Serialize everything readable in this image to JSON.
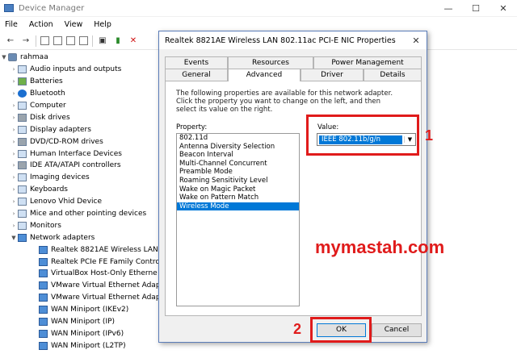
{
  "window": {
    "title": "Device Manager",
    "controls": [
      "—",
      "☐",
      "✕"
    ]
  },
  "menu": [
    "File",
    "Action",
    "View",
    "Help"
  ],
  "tree": {
    "root": "rahmaa",
    "categories": [
      "Audio inputs and outputs",
      "Batteries",
      "Bluetooth",
      "Computer",
      "Disk drives",
      "Display adapters",
      "DVD/CD-ROM drives",
      "Human Interface Devices",
      "IDE ATA/ATAPI controllers",
      "Imaging devices",
      "Keyboards",
      "Lenovo Vhid Device",
      "Mice and other pointing devices",
      "Monitors"
    ],
    "network_adapters": "Network adapters",
    "network_items": [
      "Realtek 8821AE Wireless LAN 8",
      "Realtek PCIe FE Family Contro",
      "VirtualBox Host-Only Etherne",
      "VMware Virtual Ethernet Adap",
      "VMware Virtual Ethernet Adap",
      "WAN Miniport (IKEv2)",
      "WAN Miniport (IP)",
      "WAN Miniport (IPv6)",
      "WAN Miniport (L2TP)"
    ]
  },
  "dialog": {
    "title": "Realtek 8821AE Wireless LAN 802.11ac PCI-E NIC Properties",
    "tabs_top": [
      "Events",
      "Resources",
      "Power Management"
    ],
    "tabs_bottom": [
      "General",
      "Advanced",
      "Driver",
      "Details"
    ],
    "description": "The following properties are available for this network adapter. Click the property you want to change on the left, and then select its value on the right.",
    "property_label": "Property:",
    "properties": [
      "802.11d",
      "Antenna Diversity Selection",
      "Beacon Interval",
      "Multi-Channel Concurrent",
      "Preamble Mode",
      "Roaming Sensitivity Level",
      "Wake on Magic Packet",
      "Wake on Pattern Match",
      "Wireless Mode"
    ],
    "selected_property": "Wireless Mode",
    "value_label": "Value:",
    "value": "IEEE 802.11b/g/n",
    "ok": "OK",
    "cancel": "Cancel"
  },
  "annotations": {
    "step1": "1",
    "step2": "2",
    "watermark": "mymastah.com",
    "color": "#e01b1b"
  }
}
